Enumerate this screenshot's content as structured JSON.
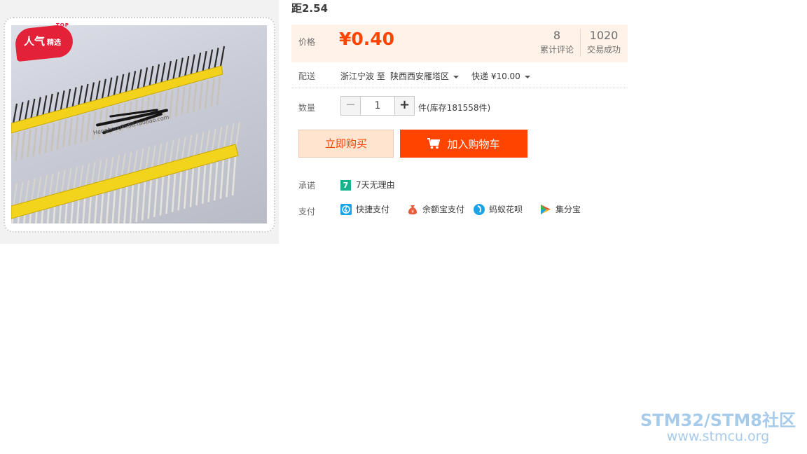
{
  "product": {
    "title_fragment": "距2.54",
    "badge": {
      "top": "TOP",
      "main": "人气",
      "sub": "精选"
    },
    "image_url_text": "Henghongke88.taobao.com"
  },
  "price": {
    "label": "价格",
    "value": "¥0.40",
    "comments_count": "8",
    "comments_label": "累计评论",
    "deals_count": "1020",
    "deals_label": "交易成功"
  },
  "shipping": {
    "label": "配送",
    "origin": "浙江宁波 至",
    "destination": "陕西西安雁塔区",
    "method": "快递 ¥10.00"
  },
  "quantity": {
    "label": "数量",
    "minus": "−",
    "value": "1",
    "plus": "+",
    "stock_text": "件(库存181558件)"
  },
  "actions": {
    "buy_now": "立即购买",
    "add_to_cart": "加入购物车"
  },
  "promise": {
    "label": "承诺",
    "icon_text": "7",
    "text": "7天无理由"
  },
  "payment": {
    "label": "支付",
    "methods": [
      "快捷支付",
      "余额宝支付",
      "蚂蚁花呗",
      "集分宝"
    ]
  },
  "watermark": {
    "brand": "STM32/STM8社区",
    "url": "www.stmcu.org"
  },
  "colors": {
    "accent": "#ff4400",
    "price_bg": "#fff2e8",
    "buy_now_bg": "#ffe4d0",
    "promise_green": "#19b28c",
    "watermark_blue": "#a7cbea"
  }
}
